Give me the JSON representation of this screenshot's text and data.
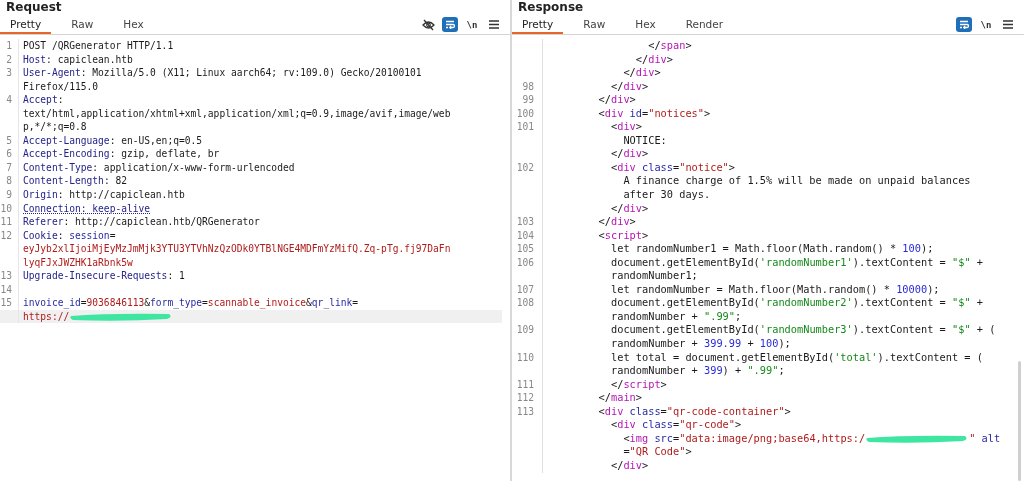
{
  "panels": [
    {
      "title": "Request",
      "tabs": [
        {
          "label": "Pretty",
          "selected": true
        },
        {
          "label": "Raw",
          "selected": false
        },
        {
          "label": "Hex",
          "selected": false
        }
      ],
      "toolbar": [
        {
          "kind": "hide",
          "on": false
        },
        {
          "kind": "wrap",
          "on": true
        },
        {
          "kind": "newline",
          "label": "\\n",
          "on": false
        },
        {
          "kind": "menu"
        }
      ],
      "lines": [
        {
          "number": "1",
          "current": false,
          "tokens": [
            {
              "kind": "plain",
              "text": "POST /QRGenerator HTTP/1.1"
            }
          ]
        },
        {
          "number": "2",
          "current": false,
          "tokens": [
            {
              "kind": "key",
              "text": "Host"
            },
            {
              "kind": "plain",
              "text": ": capiclean.htb"
            }
          ]
        },
        {
          "number": "3",
          "current": false,
          "tokens": [
            {
              "kind": "key",
              "text": "User-Agent"
            },
            {
              "kind": "plain",
              "text": ": Mozilla/5.0 (X11; Linux aarch64; rv:109.0) Gecko/20100101"
            }
          ]
        },
        {
          "current": false,
          "tokens": [
            {
              "kind": "plain",
              "text": "Firefox/115.0"
            }
          ]
        },
        {
          "number": "4",
          "current": false,
          "tokens": [
            {
              "kind": "key",
              "text": "Accept"
            },
            {
              "kind": "plain",
              "text": ":"
            }
          ]
        },
        {
          "current": false,
          "tokens": [
            {
              "kind": "plain",
              "text": "text/html,application/xhtml+xml,application/xml;q=0.9,image/avif,image/web"
            }
          ]
        },
        {
          "current": false,
          "tokens": [
            {
              "kind": "plain",
              "text": "p,*/*;q=0.8"
            }
          ]
        },
        {
          "number": "5",
          "current": false,
          "tokens": [
            {
              "kind": "key",
              "text": "Accept-Language"
            },
            {
              "kind": "plain",
              "text": ": en-US,en;q=0.5"
            }
          ]
        },
        {
          "number": "6",
          "current": false,
          "tokens": [
            {
              "kind": "key",
              "text": "Accept-Encoding"
            },
            {
              "kind": "plain",
              "text": ": gzip, deflate, br"
            }
          ]
        },
        {
          "number": "7",
          "current": false,
          "tokens": [
            {
              "kind": "key",
              "text": "Content-Type"
            },
            {
              "kind": "plain",
              "text": ": application/x-www-form-urlencoded"
            }
          ]
        },
        {
          "number": "8",
          "current": false,
          "tokens": [
            {
              "kind": "key",
              "text": "Content-Length"
            },
            {
              "kind": "plain",
              "text": ": 82"
            }
          ]
        },
        {
          "number": "9",
          "current": false,
          "tokens": [
            {
              "kind": "key",
              "text": "Origin"
            },
            {
              "kind": "plain",
              "text": ": http://capiclean.htb"
            }
          ]
        },
        {
          "number": "10",
          "current": false,
          "tokens": [
            {
              "kind": "flagged",
              "text": "Connection: keep-alive"
            }
          ]
        },
        {
          "number": "11",
          "current": false,
          "tokens": [
            {
              "kind": "key",
              "text": "Referer"
            },
            {
              "kind": "plain",
              "text": ": http://capiclean.htb/QRGenerator"
            }
          ]
        },
        {
          "number": "12",
          "current": false,
          "tokens": [
            {
              "kind": "key",
              "text": "Cookie"
            },
            {
              "kind": "plain",
              "text": ": "
            },
            {
              "kind": "attr",
              "text": "session"
            },
            {
              "kind": "plain",
              "text": "="
            }
          ]
        },
        {
          "current": false,
          "tokens": [
            {
              "kind": "value",
              "text": "eyJyb2xlIjoiMjEyMzJmMjk3YTU3YTVhNzQzODk0YTBlNGE4MDFmYzMifQ.Zq-pTg.fj97DaFn"
            }
          ]
        },
        {
          "current": false,
          "tokens": [
            {
              "kind": "value",
              "text": "lyqFJxJWZHK1aRbnk5w"
            }
          ]
        },
        {
          "number": "13",
          "current": false,
          "tokens": [
            {
              "kind": "key",
              "text": "Upgrade-Insecure-Requests"
            },
            {
              "kind": "plain",
              "text": ": 1"
            }
          ]
        },
        {
          "number": "14",
          "current": false
        },
        {
          "number": "15",
          "current": false,
          "tokens": [
            {
              "kind": "attr",
              "text": "invoice_id"
            },
            {
              "kind": "plain",
              "text": "="
            },
            {
              "kind": "value",
              "text": "9036846113"
            },
            {
              "kind": "plain",
              "text": "&"
            },
            {
              "kind": "attr",
              "text": "form_type"
            },
            {
              "kind": "plain",
              "text": "="
            },
            {
              "kind": "value",
              "text": "scannable_invoice"
            },
            {
              "kind": "plain",
              "text": "&"
            },
            {
              "kind": "attr",
              "text": "qr_link"
            },
            {
              "kind": "plain",
              "text": "="
            }
          ]
        },
        {
          "current": true,
          "tokens": [
            {
              "kind": "value",
              "text": "https://"
            },
            {
              "kind": "redaction"
            }
          ]
        }
      ]
    },
    {
      "title": "Response",
      "tabs": [
        {
          "label": "Pretty",
          "selected": true
        },
        {
          "label": "Raw",
          "selected": false
        },
        {
          "label": "Hex",
          "selected": false
        },
        {
          "label": "Render",
          "selected": false
        }
      ],
      "toolbar": [
        {
          "kind": "wrap",
          "on": true
        },
        {
          "kind": "newline",
          "label": "\\n",
          "on": false
        },
        {
          "kind": "menu"
        }
      ],
      "lines": [
        {
          "tokens": [
            {
              "kind": "plain",
              "text": "                </"
            },
            {
              "kind": "tag",
              "text": "span"
            },
            {
              "kind": "plain",
              "text": ">"
            }
          ]
        },
        {
          "tokens": [
            {
              "kind": "plain",
              "text": "              </"
            },
            {
              "kind": "tag",
              "text": "div"
            },
            {
              "kind": "plain",
              "text": ">"
            }
          ]
        },
        {
          "tokens": [
            {
              "kind": "plain",
              "text": "            </"
            },
            {
              "kind": "tag",
              "text": "div"
            },
            {
              "kind": "plain",
              "text": ">"
            }
          ]
        },
        {
          "number": "98",
          "tokens": [
            {
              "kind": "plain",
              "text": "          </"
            },
            {
              "kind": "tag",
              "text": "div"
            },
            {
              "kind": "plain",
              "text": ">"
            }
          ]
        },
        {
          "number": "99",
          "tokens": [
            {
              "kind": "plain",
              "text": "        </"
            },
            {
              "kind": "tag",
              "text": "div"
            },
            {
              "kind": "plain",
              "text": ">"
            }
          ]
        },
        {
          "number": "100",
          "tokens": [
            {
              "kind": "plain",
              "text": "        <"
            },
            {
              "kind": "tag",
              "text": "div"
            },
            {
              "kind": "attr",
              "text": " id"
            },
            {
              "kind": "plain",
              "text": "="
            },
            {
              "kind": "value",
              "text": "\"notices\""
            },
            {
              "kind": "plain",
              "text": ">"
            }
          ]
        },
        {
          "number": "101",
          "tokens": [
            {
              "kind": "plain",
              "text": "          <"
            },
            {
              "kind": "tag",
              "text": "div"
            },
            {
              "kind": "plain",
              "text": ">"
            }
          ]
        },
        {
          "tokens": [
            {
              "kind": "plain",
              "text": "            NOTICE:"
            }
          ]
        },
        {
          "tokens": [
            {
              "kind": "plain",
              "text": "          </"
            },
            {
              "kind": "tag",
              "text": "div"
            },
            {
              "kind": "plain",
              "text": ">"
            }
          ]
        },
        {
          "number": "102",
          "tokens": [
            {
              "kind": "plain",
              "text": "          <"
            },
            {
              "kind": "tag",
              "text": "div"
            },
            {
              "kind": "attr",
              "text": " class"
            },
            {
              "kind": "plain",
              "text": "="
            },
            {
              "kind": "value",
              "text": "\"notice\""
            },
            {
              "kind": "plain",
              "text": ">"
            }
          ]
        },
        {
          "tokens": [
            {
              "kind": "plain",
              "text": "            A finance charge of 1.5% will be made on unpaid balances"
            }
          ]
        },
        {
          "tokens": [
            {
              "kind": "plain",
              "text": "            after 30 days."
            }
          ]
        },
        {
          "tokens": [
            {
              "kind": "plain",
              "text": "          </"
            },
            {
              "kind": "tag",
              "text": "div"
            },
            {
              "kind": "plain",
              "text": ">"
            }
          ]
        },
        {
          "number": "103",
          "tokens": [
            {
              "kind": "plain",
              "text": "        </"
            },
            {
              "kind": "tag",
              "text": "div"
            },
            {
              "kind": "plain",
              "text": ">"
            }
          ]
        },
        {
          "number": "104",
          "tokens": [
            {
              "kind": "plain",
              "text": "        <"
            },
            {
              "kind": "tag",
              "text": "script"
            },
            {
              "kind": "plain",
              "text": ">"
            }
          ]
        },
        {
          "number": "105",
          "tokens": [
            {
              "kind": "plain",
              "text": "          let randomNumber1 = Math.floor(Math.random() * "
            },
            {
              "kind": "number",
              "text": "100"
            },
            {
              "kind": "plain",
              "text": ");"
            }
          ]
        },
        {
          "number": "106",
          "tokens": [
            {
              "kind": "plain",
              "text": "          document.getElementById("
            },
            {
              "kind": "string",
              "text": "'randomNumber1'"
            },
            {
              "kind": "plain",
              "text": ").textContent = "
            },
            {
              "kind": "string",
              "text": "\"$\""
            },
            {
              "kind": "plain",
              "text": " +"
            }
          ]
        },
        {
          "tokens": [
            {
              "kind": "plain",
              "text": "          randomNumber1;"
            }
          ]
        },
        {
          "number": "107",
          "tokens": [
            {
              "kind": "plain",
              "text": "          let randomNumber = Math.floor(Math.random() * "
            },
            {
              "kind": "number",
              "text": "10000"
            },
            {
              "kind": "plain",
              "text": ");"
            }
          ]
        },
        {
          "number": "108",
          "tokens": [
            {
              "kind": "plain",
              "text": "          document.getElementById("
            },
            {
              "kind": "string",
              "text": "'randomNumber2'"
            },
            {
              "kind": "plain",
              "text": ").textContent = "
            },
            {
              "kind": "string",
              "text": "\"$\""
            },
            {
              "kind": "plain",
              "text": " +"
            }
          ]
        },
        {
          "tokens": [
            {
              "kind": "plain",
              "text": "          randomNumber + "
            },
            {
              "kind": "string",
              "text": "\".99\""
            },
            {
              "kind": "plain",
              "text": ";"
            }
          ]
        },
        {
          "number": "109",
          "tokens": [
            {
              "kind": "plain",
              "text": "          document.getElementById("
            },
            {
              "kind": "string",
              "text": "'randomNumber3'"
            },
            {
              "kind": "plain",
              "text": ").textContent = "
            },
            {
              "kind": "string",
              "text": "\"$\""
            },
            {
              "kind": "plain",
              "text": " + ("
            }
          ]
        },
        {
          "tokens": [
            {
              "kind": "plain",
              "text": "          randomNumber + "
            },
            {
              "kind": "number",
              "text": "399.99"
            },
            {
              "kind": "plain",
              "text": " + "
            },
            {
              "kind": "number",
              "text": "100"
            },
            {
              "kind": "plain",
              "text": ");"
            }
          ]
        },
        {
          "number": "110",
          "tokens": [
            {
              "kind": "plain",
              "text": "          let total = document.getElementById("
            },
            {
              "kind": "string",
              "text": "'total'"
            },
            {
              "kind": "plain",
              "text": ").textContent = ("
            }
          ]
        },
        {
          "tokens": [
            {
              "kind": "plain",
              "text": "          randomNumber + "
            },
            {
              "kind": "number",
              "text": "399"
            },
            {
              "kind": "plain",
              "text": ") + "
            },
            {
              "kind": "string",
              "text": "\".99\""
            },
            {
              "kind": "plain",
              "text": ";"
            }
          ]
        },
        {
          "number": "111",
          "tokens": [
            {
              "kind": "plain",
              "text": "          </"
            },
            {
              "kind": "tag",
              "text": "script"
            },
            {
              "kind": "plain",
              "text": ">"
            }
          ]
        },
        {
          "number": "112",
          "tokens": [
            {
              "kind": "plain",
              "text": "        </"
            },
            {
              "kind": "tag",
              "text": "main"
            },
            {
              "kind": "plain",
              "text": ">"
            }
          ]
        },
        {
          "number": "113",
          "tokens": [
            {
              "kind": "plain",
              "text": "        <"
            },
            {
              "kind": "tag",
              "text": "div"
            },
            {
              "kind": "attr",
              "text": " class"
            },
            {
              "kind": "plain",
              "text": "="
            },
            {
              "kind": "value",
              "text": "\"qr-code-container\""
            },
            {
              "kind": "plain",
              "text": ">"
            }
          ]
        },
        {
          "tokens": [
            {
              "kind": "plain",
              "text": "          <"
            },
            {
              "kind": "tag",
              "text": "div"
            },
            {
              "kind": "attr",
              "text": " class"
            },
            {
              "kind": "plain",
              "text": "="
            },
            {
              "kind": "value",
              "text": "\"qr-code\""
            },
            {
              "kind": "plain",
              "text": ">"
            }
          ]
        },
        {
          "tokens": [
            {
              "kind": "plain",
              "text": "            <"
            },
            {
              "kind": "tag",
              "text": "img"
            },
            {
              "kind": "attr",
              "text": " src"
            },
            {
              "kind": "plain",
              "text": "="
            },
            {
              "kind": "value",
              "text": "\"data:image/png;base64,https:/"
            },
            {
              "kind": "redaction"
            },
            {
              "kind": "value",
              "text": "\""
            },
            {
              "kind": "attr",
              "text": " alt"
            }
          ]
        },
        {
          "tokens": [
            {
              "kind": "plain",
              "text": "            ="
            },
            {
              "kind": "value",
              "text": "\"QR Code\""
            },
            {
              "kind": "plain",
              "text": ">"
            }
          ]
        },
        {
          "tokens": [
            {
              "kind": "plain",
              "text": "          </"
            },
            {
              "kind": "tag",
              "text": "div"
            },
            {
              "kind": "plain",
              "text": ">"
            }
          ]
        }
      ]
    }
  ]
}
